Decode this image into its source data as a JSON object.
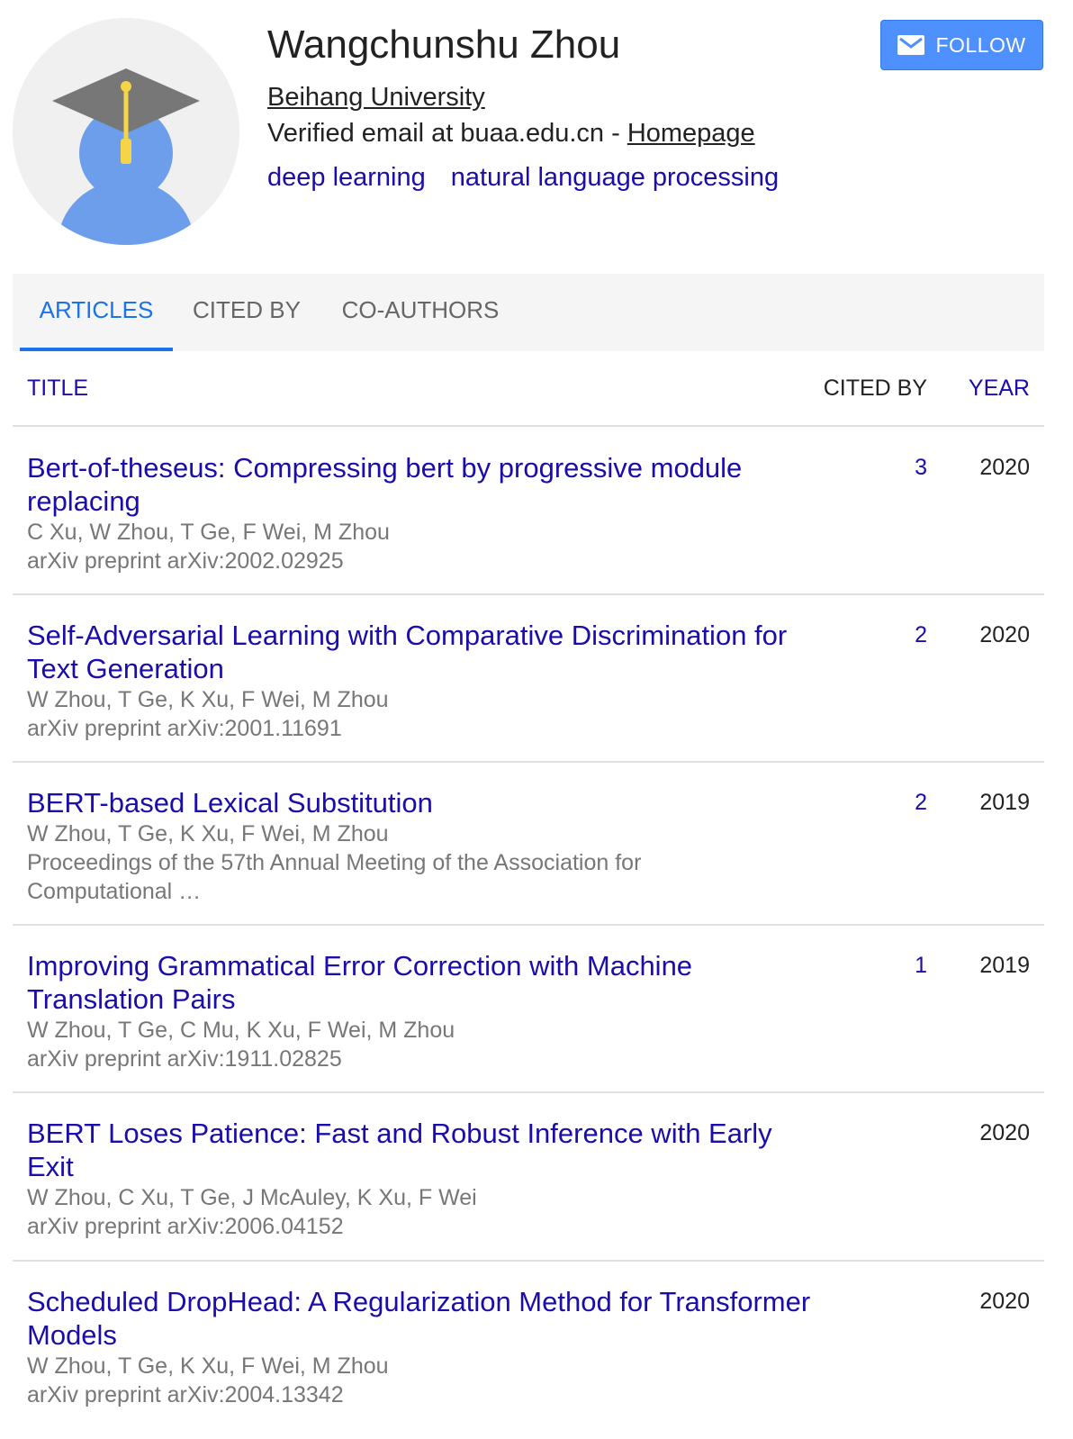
{
  "profile": {
    "name": "Wangchunshu Zhou",
    "affiliation": "Beihang University",
    "email_text": "Verified email at buaa.edu.cn - ",
    "homepage_label": "Homepage",
    "interests": [
      "deep learning",
      "natural language processing"
    ]
  },
  "follow_label": "FOLLOW",
  "tabs": [
    {
      "label": "ARTICLES",
      "active": true
    },
    {
      "label": "CITED BY",
      "active": false
    },
    {
      "label": "CO-AUTHORS",
      "active": false
    }
  ],
  "table": {
    "col_title": "TITLE",
    "col_cited": "CITED BY",
    "col_year": "YEAR"
  },
  "articles": [
    {
      "title": "Bert-of-theseus: Compressing bert by progressive module replacing",
      "authors": "C Xu, W Zhou, T Ge, F Wei, M Zhou",
      "venue": "arXiv preprint arXiv:2002.02925",
      "cited_by": "3",
      "year": "2020"
    },
    {
      "title": "Self-Adversarial Learning with Comparative Discrimination for Text Generation",
      "authors": "W Zhou, T Ge, K Xu, F Wei, M Zhou",
      "venue": "arXiv preprint arXiv:2001.11691",
      "cited_by": "2",
      "year": "2020"
    },
    {
      "title": "BERT-based Lexical Substitution",
      "authors": "W Zhou, T Ge, K Xu, F Wei, M Zhou",
      "venue": "Proceedings of the 57th Annual Meeting of the Association for Computational …",
      "cited_by": "2",
      "year": "2019"
    },
    {
      "title": "Improving Grammatical Error Correction with Machine Translation Pairs",
      "authors": "W Zhou, T Ge, C Mu, K Xu, F Wei, M Zhou",
      "venue": "arXiv preprint arXiv:1911.02825",
      "cited_by": "1",
      "year": "2019"
    },
    {
      "title": "BERT Loses Patience: Fast and Robust Inference with Early Exit",
      "authors": "W Zhou, C Xu, T Ge, J McAuley, K Xu, F Wei",
      "venue": "arXiv preprint arXiv:2006.04152",
      "cited_by": "",
      "year": "2020"
    },
    {
      "title": "Scheduled DropHead: A Regularization Method for Transformer Models",
      "authors": "W Zhou, T Ge, K Xu, F Wei, M Zhou",
      "venue": "arXiv preprint arXiv:2004.13342",
      "cited_by": "",
      "year": "2020"
    }
  ],
  "icons": {
    "avatar": "scholar-default-avatar-icon",
    "follow": "mail-envelope-icon"
  },
  "colors": {
    "link": "#1a0dab",
    "accent": "#1a73e8",
    "follow_button": "#4d90fe",
    "meta_text": "#777777"
  }
}
